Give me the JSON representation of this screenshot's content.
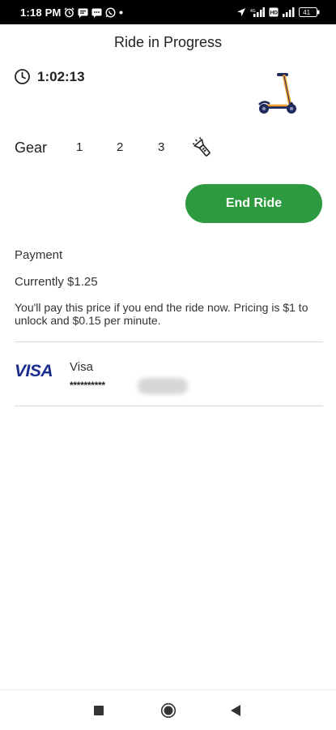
{
  "status_bar": {
    "time": "1:18 PM",
    "battery": "41",
    "left_icons": [
      "alarm-icon",
      "message-icon",
      "chat-icon",
      "whatsapp-icon",
      "dot-icon"
    ],
    "right_icons": [
      "location-icon",
      "signal-icon",
      "volte-icon",
      "signal-icon",
      "battery-icon"
    ]
  },
  "header": {
    "title": "Ride in Progress"
  },
  "ride": {
    "timer_icon": "clock-icon",
    "elapsed": "1:02:13",
    "vehicle_icon": "scooter-icon"
  },
  "gear": {
    "label": "Gear",
    "options": [
      "1",
      "2",
      "3"
    ],
    "light_icon": "flashlight-icon"
  },
  "actions": {
    "end_ride": "End Ride",
    "end_ride_color": "#2e9a3f"
  },
  "payment": {
    "heading": "Payment",
    "current": "Currently $1.25",
    "note": "You'll pay this price if you end the ride now. Pricing is $1 to unlock and $0.15 per minute.",
    "card": {
      "brand_logo": "VISA",
      "name": "Visa",
      "masked_number": "**********"
    }
  },
  "nav_bar": {
    "buttons": [
      "recents-icon",
      "home-icon",
      "back-icon"
    ]
  }
}
